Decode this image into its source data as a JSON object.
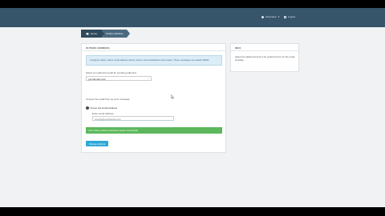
{
  "topbar": {
    "user_label": "Username",
    "logout_label": "Logout"
  },
  "breadcrumb": {
    "home": "Home",
    "current": "Outbox Address"
  },
  "main_panel": {
    "title": "OUTBOX ADDRESS",
    "info_text": "Configure which outbox email address will be used to send notifications and replies. These messages are usually SPAM.",
    "select_label": "Select an outbound email for sending outbound",
    "select_value": "yourdomain.com",
    "radio_section_label": "Choose the email from as error message",
    "radio_option": "Preset the Email Address",
    "email_label": "Enter email address",
    "email_value": "noreply@yourdomain.com",
    "success_message": "Your outbox address has been saved successfully",
    "save_button": "Change address"
  },
  "side_panel": {
    "title": "INFO",
    "text": "Select the default account to be outbound from for the email template."
  },
  "colors": {
    "header": "#36546a",
    "info_bg": "#dcedf7",
    "success": "#5cb85c",
    "primary_button": "#2fa8d8"
  },
  "icons": [
    "user-icon",
    "caret-down-icon",
    "logout-icon",
    "home-icon",
    "chevron-down-icon",
    "radio-icon"
  ]
}
